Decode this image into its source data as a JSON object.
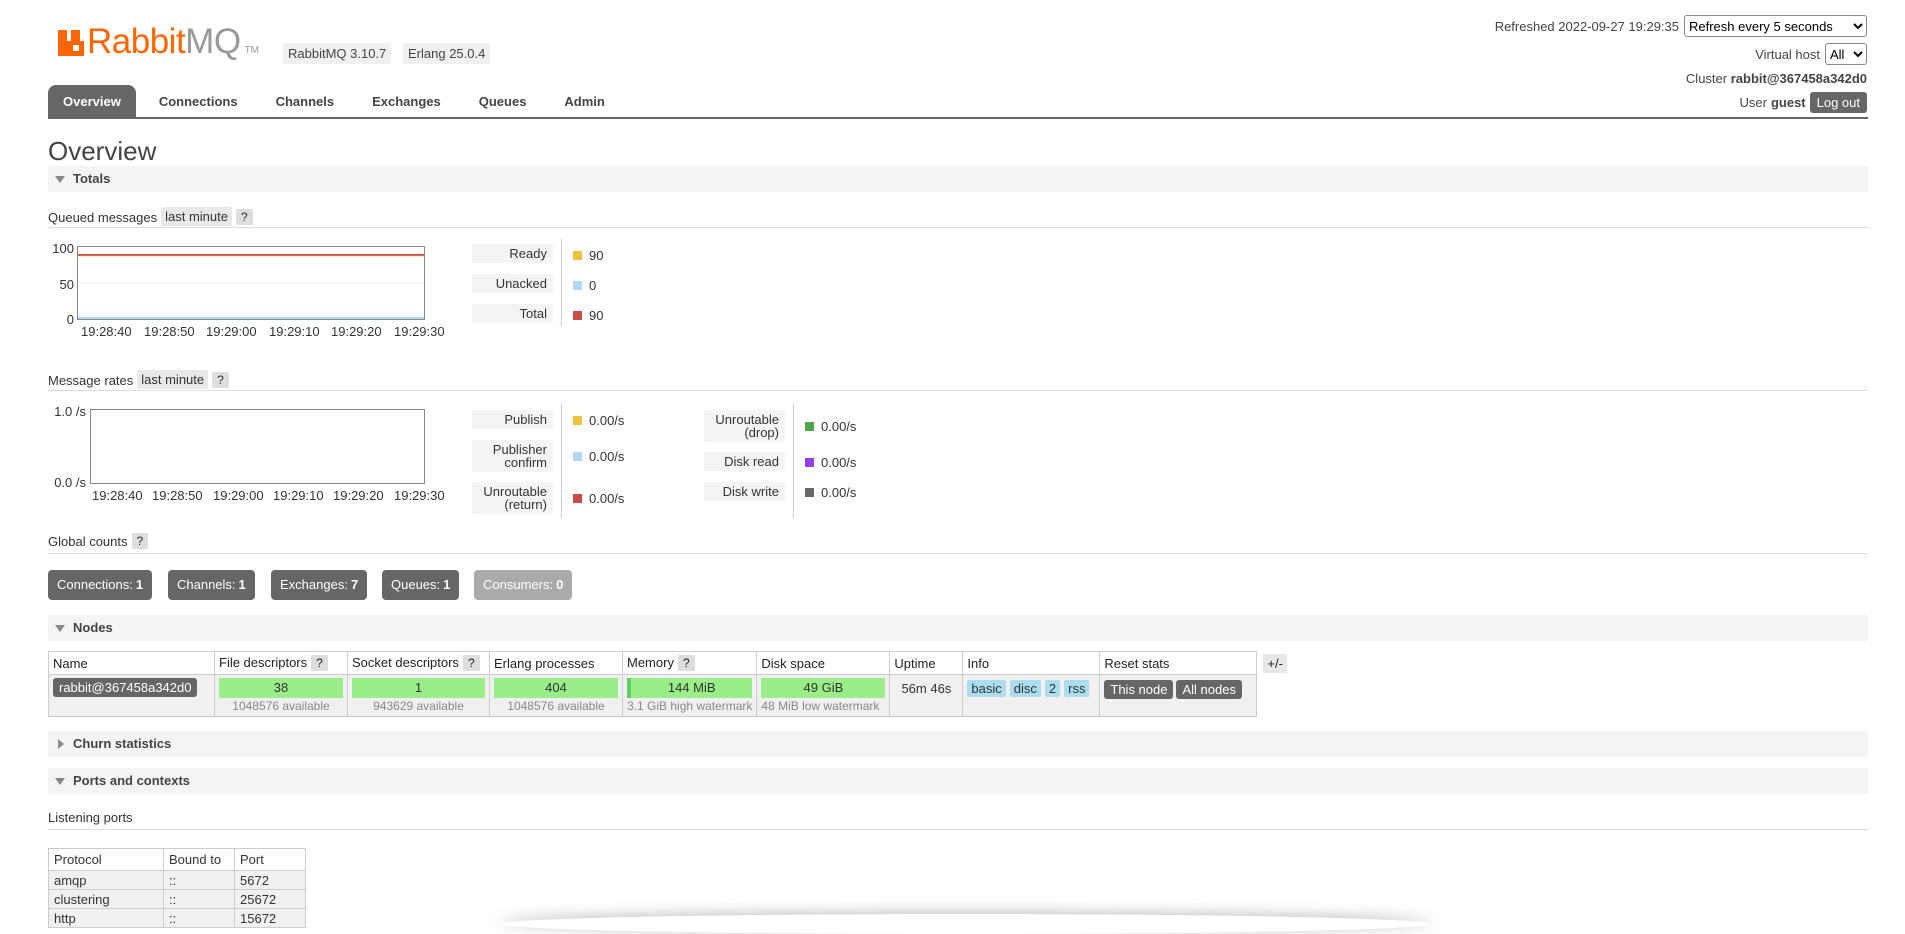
{
  "header": {
    "logo_rabbit": "Rabbit",
    "logo_mq": "MQ",
    "logo_tm": "TM",
    "rabbitmq_version": "RabbitMQ 3.10.7",
    "erlang_version": "Erlang 25.0.4",
    "refreshed_label": "Refreshed 2022-09-27 19:29:35",
    "refresh_select": "Refresh every 5 seconds",
    "vhost_label": "Virtual host",
    "vhost_select": "All",
    "cluster_label": "Cluster",
    "cluster_name": "rabbit@367458a342d0",
    "user_label": "User",
    "user_name": "guest",
    "logout": "Log out"
  },
  "tabs": [
    "Overview",
    "Connections",
    "Channels",
    "Exchanges",
    "Queues",
    "Admin"
  ],
  "page_title": "Overview",
  "sections": {
    "totals": "Totals",
    "nodes": "Nodes",
    "churn": "Churn statistics",
    "ports": "Ports and contexts"
  },
  "queued": {
    "label": "Queued messages",
    "range": "last minute",
    "help": "?",
    "y_ticks": [
      "100",
      "50",
      "0"
    ],
    "x_ticks": [
      "19:28:40",
      "19:28:50",
      "19:29:00",
      "19:29:10",
      "19:29:20",
      "19:29:30"
    ],
    "legend": [
      {
        "label": "Ready",
        "value": "90",
        "color": "#edc240"
      },
      {
        "label": "Unacked",
        "value": "0",
        "color": "#afd8f8"
      },
      {
        "label": "Total",
        "value": "90",
        "color": "#cb4b4b"
      }
    ]
  },
  "rates": {
    "label": "Message rates",
    "range": "last minute",
    "help": "?",
    "y_ticks": [
      "1.0 /s",
      "0.0 /s"
    ],
    "x_ticks": [
      "19:28:40",
      "19:28:50",
      "19:29:00",
      "19:29:10",
      "19:29:20",
      "19:29:30"
    ],
    "legend_left": [
      {
        "label": "Publish",
        "value": "0.00/s",
        "color": "#edc240"
      },
      {
        "label": "Publisher confirm",
        "value": "0.00/s",
        "color": "#afd8f8"
      },
      {
        "label": "Unroutable (return)",
        "value": "0.00/s",
        "color": "#cb4b4b"
      }
    ],
    "legend_right": [
      {
        "label": "Unroutable (drop)",
        "value": "0.00/s",
        "color": "#4da74d"
      },
      {
        "label": "Disk read",
        "value": "0.00/s",
        "color": "#9440ed"
      },
      {
        "label": "Disk write",
        "value": "0.00/s",
        "color": "#666666"
      }
    ]
  },
  "global_counts": {
    "label": "Global counts",
    "help": "?",
    "items": [
      {
        "label": "Connections:",
        "value": "1"
      },
      {
        "label": "Channels:",
        "value": "1"
      },
      {
        "label": "Exchanges:",
        "value": "7"
      },
      {
        "label": "Queues:",
        "value": "1"
      },
      {
        "label": "Consumers:",
        "value": "0"
      }
    ]
  },
  "nodes": {
    "headers": [
      "Name",
      "File descriptors",
      "Socket descriptors",
      "Erlang processes",
      "Memory",
      "Disk space",
      "Uptime",
      "Info",
      "Reset stats"
    ],
    "help": "?",
    "plusminus": "+/-",
    "row": {
      "name": "rabbit@367458a342d0",
      "fd": "38",
      "fd_avail": "1048576 available",
      "fd_fraction": 4e-05,
      "sock": "1",
      "sock_avail": "943629 available",
      "sock_fraction": 1e-06,
      "proc": "404",
      "proc_avail": "1048576 available",
      "proc_fraction": 0.0004,
      "mem": "144 MiB",
      "mem_note": "3.1 GiB high watermark",
      "mem_fraction": 0.045,
      "disk": "49 GiB",
      "disk_note": "48 MiB low watermark",
      "uptime": "56m 46s",
      "info": [
        "basic",
        "disc",
        "2",
        "rss"
      ],
      "reset_this": "This node",
      "reset_all": "All nodes"
    }
  },
  "ports": {
    "label": "Listening ports",
    "headers": [
      "Protocol",
      "Bound to",
      "Port"
    ],
    "rows": [
      [
        "amqp",
        "::",
        "5672"
      ],
      [
        "clustering",
        "::",
        "25672"
      ],
      [
        "http",
        "::",
        "15672"
      ]
    ]
  }
}
